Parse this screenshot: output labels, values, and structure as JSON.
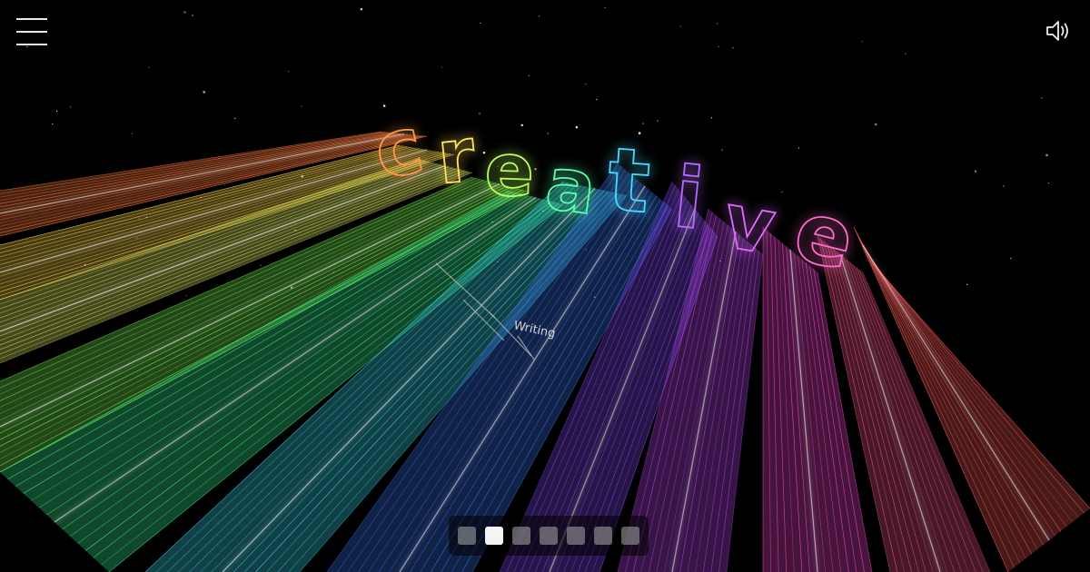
{
  "scene": {
    "headline": "creative",
    "sublabel": "Writing",
    "beam_colors": [
      "#ff7a3c",
      "#ffd84a",
      "#f3ff6a",
      "#7dff55",
      "#3cff9a",
      "#3ce8ff",
      "#3c7bff",
      "#8a4cff",
      "#c94cff",
      "#ff4cd8",
      "#ff5a8c",
      "#ff5a5a"
    ],
    "letter_colors": [
      "#ff9a4a",
      "#ffe35a",
      "#b6ff5a",
      "#5affb0",
      "#4ad8ff",
      "#b86bff",
      "#e06bff",
      "#ff6bcc"
    ]
  },
  "controls": {
    "menu_icon": "hamburger-icon",
    "sound_icon": "speaker-icon"
  },
  "pager": {
    "count": 7,
    "active_index": 1
  }
}
